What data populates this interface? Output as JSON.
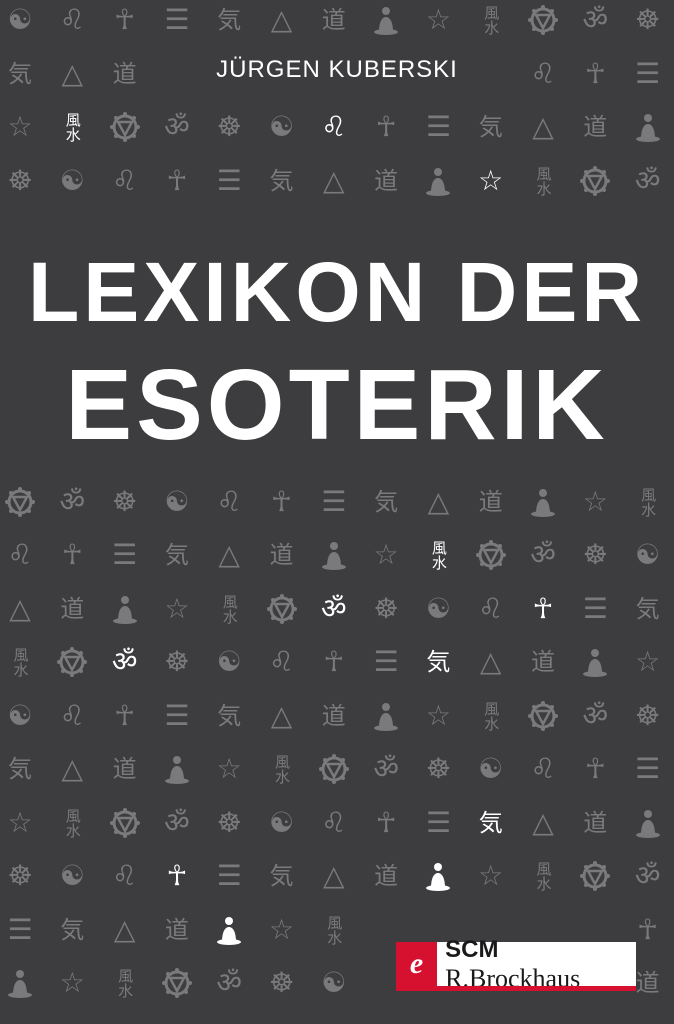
{
  "cover": {
    "author": "JÜRGEN KUBERSKI",
    "title_line1": "LEXIKON DER",
    "title_line2": "ESOTERIK",
    "publisher_logo_letter": "e",
    "publisher_prefix": "SCM",
    "publisher_name": "R.Brockhaus"
  },
  "colors": {
    "background": "#3d3d40",
    "symbol_gray": "#7a7a7c",
    "symbol_white": "#ffffff",
    "publisher_red": "#d5112f"
  },
  "symbol_sequence": [
    "yinyang-icon",
    "leo-icon",
    "ankh-icon",
    "bagua-icon",
    "qi-icon",
    "masonic-icon",
    "dao-icon",
    "buddha-icon",
    "pentagram-icon",
    "fengshui-icon",
    "chakra-icon",
    "om-icon",
    "dharma-wheel-icon"
  ],
  "symbol_glyphs": {
    "yinyang-icon": "☯",
    "leo-icon": "♌",
    "ankh-icon": "☥",
    "bagua-icon": "☰",
    "qi-icon": "気",
    "masonic-icon": "△",
    "dao-icon": "道",
    "buddha-icon": "",
    "pentagram-icon": "☆",
    "fengshui-icon": "風水",
    "chakra-icon": "",
    "om-icon": "ॐ",
    "dharma-wheel-icon": "☸"
  }
}
